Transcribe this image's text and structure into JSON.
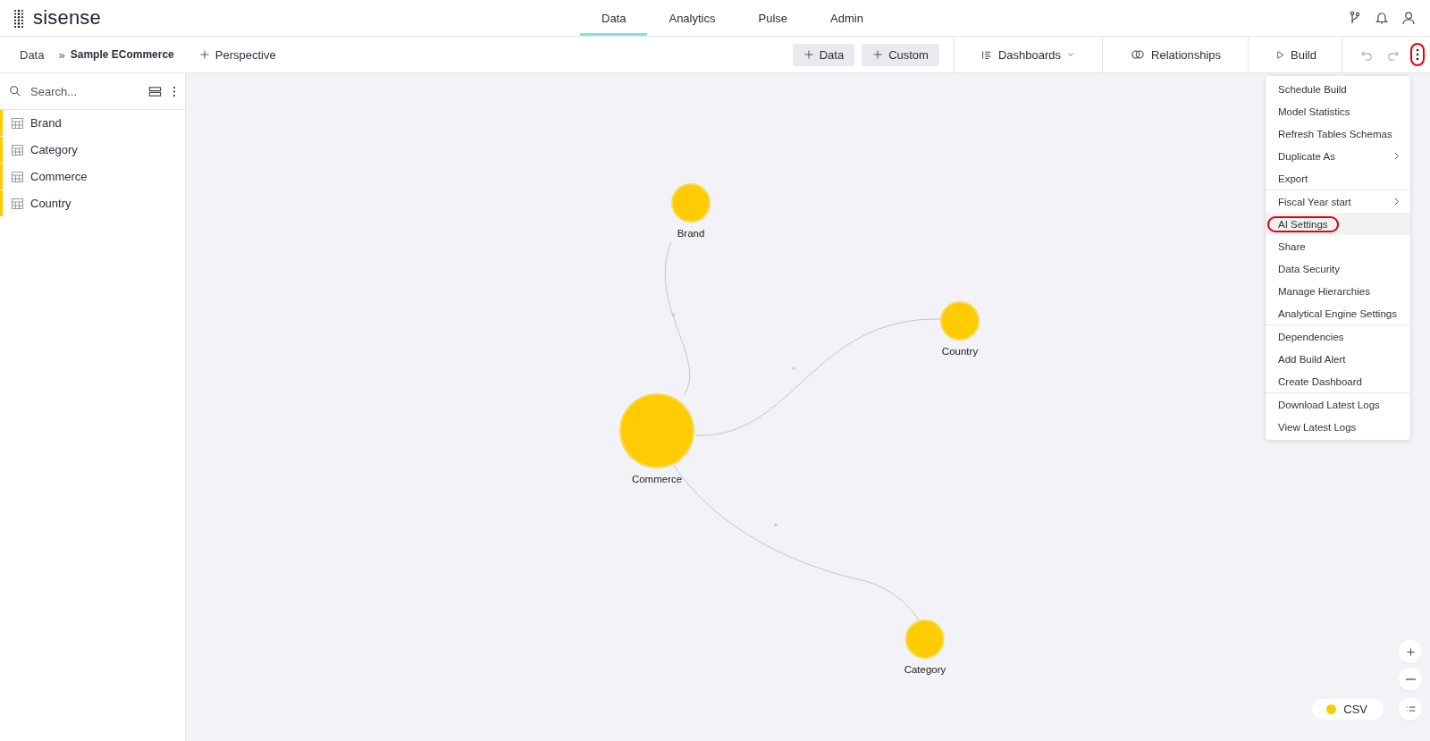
{
  "app": {
    "logo": "sisense"
  },
  "nav": [
    {
      "label": "Data",
      "selected": true
    },
    {
      "label": "Analytics",
      "selected": false
    },
    {
      "label": "Pulse",
      "selected": false
    },
    {
      "label": "Admin",
      "selected": false
    }
  ],
  "toolbar": {
    "breadcrumb": [
      "Data",
      "Sample ECommerce"
    ],
    "breadcrumb_separator": "»",
    "perspective": "Perspective",
    "add_data": "Data",
    "add_custom": "Custom",
    "dashboards": "Dashboards",
    "relationships": "Relationships",
    "build": "Build",
    "more_highlighted": true
  },
  "sidebar": {
    "search": {
      "placeholder": "Search..."
    },
    "tables": [
      {
        "label": "Brand"
      },
      {
        "label": "Category"
      },
      {
        "label": "Commerce"
      },
      {
        "label": "Country"
      }
    ]
  },
  "nodes": [
    {
      "label": "Brand",
      "kind": "leaf"
    },
    {
      "label": "Country",
      "kind": "leaf"
    },
    {
      "label": "Commerce",
      "kind": "hub"
    },
    {
      "label": "Category",
      "kind": "leaf"
    }
  ],
  "legend": [
    {
      "label": "CSV",
      "color": "#ffcb05"
    }
  ],
  "menu": [
    [
      {
        "label": "Schedule Build",
        "selected": false,
        "submenu": false,
        "highlighted": false
      },
      {
        "label": "Model Statistics",
        "selected": false,
        "submenu": false,
        "highlighted": false
      },
      {
        "label": "Refresh Tables Schemas",
        "selected": false,
        "submenu": false,
        "highlighted": false
      },
      {
        "label": "Duplicate As",
        "selected": false,
        "submenu": true,
        "highlighted": false
      },
      {
        "label": "Export",
        "selected": false,
        "submenu": false,
        "highlighted": false
      }
    ],
    [
      {
        "label": "Fiscal Year start",
        "selected": false,
        "submenu": true,
        "highlighted": false
      },
      {
        "label": "AI Settings",
        "selected": true,
        "submenu": false,
        "highlighted": true
      },
      {
        "label": "Share",
        "selected": false,
        "submenu": false,
        "highlighted": false
      },
      {
        "label": "Data Security",
        "selected": false,
        "submenu": false,
        "highlighted": false
      },
      {
        "label": "Manage Hierarchies",
        "selected": false,
        "submenu": false,
        "highlighted": false
      },
      {
        "label": "Analytical Engine Settings",
        "selected": false,
        "submenu": false,
        "highlighted": false
      }
    ],
    [
      {
        "label": "Dependencies",
        "selected": false,
        "submenu": false,
        "highlighted": false
      },
      {
        "label": "Add Build Alert",
        "selected": false,
        "submenu": false,
        "highlighted": false
      },
      {
        "label": "Create Dashboard",
        "selected": false,
        "submenu": false,
        "highlighted": false
      }
    ],
    [
      {
        "label": "Download Latest Logs",
        "selected": false,
        "submenu": false,
        "highlighted": false
      },
      {
        "label": "View Latest Logs",
        "selected": false,
        "submenu": false,
        "highlighted": false
      }
    ]
  ]
}
